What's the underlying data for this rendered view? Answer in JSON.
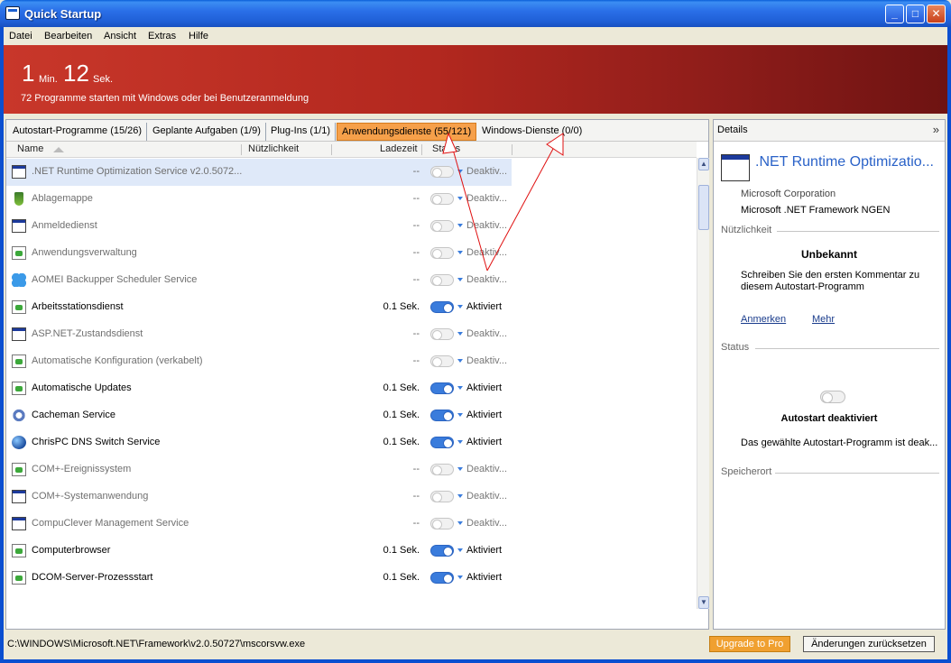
{
  "window": {
    "title": "Quick Startup",
    "min_label": "_",
    "max_label": "□",
    "close_label": "✕"
  },
  "menu": [
    "Datei",
    "Bearbeiten",
    "Ansicht",
    "Extras",
    "Hilfe"
  ],
  "banner": {
    "minutes": "1",
    "minutes_unit": "Min.",
    "seconds": "12",
    "seconds_unit": "Sek.",
    "subtext": "72 Programme starten mit Windows oder bei Benutzeranmeldung",
    "color_start": "#c8372a",
    "color_end": "#6e1312"
  },
  "tabs": [
    {
      "label": "Autostart-Programme (15/26)",
      "active": false
    },
    {
      "label": "Geplante Aufgaben (1/9)",
      "active": false
    },
    {
      "label": "Plug-Ins (1/1)",
      "active": false
    },
    {
      "label": "Anwendungsdienste (55/121)",
      "active": true
    },
    {
      "label": "Windows-Dienste (0/0)",
      "active": false
    }
  ],
  "columns": {
    "name": "Name",
    "usefulness": "Nützlichkeit",
    "load_time": "Ladezeit",
    "status": "Status"
  },
  "rows": [
    {
      "icon": "window",
      "name": ".NET Runtime Optimization Service v2.0.5072...",
      "load": "--",
      "on": false,
      "status": "Deaktiv...",
      "selected": true
    },
    {
      "icon": "plug",
      "name": "Ablagemappe",
      "load": "--",
      "on": false,
      "status": "Deaktiv..."
    },
    {
      "icon": "window",
      "name": "Anmeldedienst",
      "load": "--",
      "on": false,
      "status": "Deaktiv..."
    },
    {
      "icon": "doc",
      "name": "Anwendungsverwaltung",
      "load": "--",
      "on": false,
      "status": "Deaktiv..."
    },
    {
      "icon": "butterfly",
      "name": "AOMEI Backupper Scheduler Service",
      "load": "--",
      "on": false,
      "status": "Deaktiv..."
    },
    {
      "icon": "doc",
      "name": "Arbeitsstationsdienst",
      "load": "0.1 Sek.",
      "on": true,
      "status": "Aktiviert"
    },
    {
      "icon": "window",
      "name": "ASP.NET-Zustandsdienst",
      "load": "--",
      "on": false,
      "status": "Deaktiv..."
    },
    {
      "icon": "doc",
      "name": "Automatische Konfiguration (verkabelt)",
      "load": "--",
      "on": false,
      "status": "Deaktiv..."
    },
    {
      "icon": "doc",
      "name": "Automatische Updates",
      "load": "0.1 Sek.",
      "on": true,
      "status": "Aktiviert"
    },
    {
      "icon": "gear",
      "name": "Cacheman Service",
      "load": "0.1 Sek.",
      "on": true,
      "status": "Aktiviert"
    },
    {
      "icon": "globe",
      "name": "ChrisPC DNS Switch Service",
      "load": "0.1 Sek.",
      "on": true,
      "status": "Aktiviert"
    },
    {
      "icon": "doc",
      "name": "COM+-Ereignissystem",
      "load": "--",
      "on": false,
      "status": "Deaktiv..."
    },
    {
      "icon": "window",
      "name": "COM+-Systemanwendung",
      "load": "--",
      "on": false,
      "status": "Deaktiv..."
    },
    {
      "icon": "window",
      "name": "CompuClever Management Service",
      "load": "--",
      "on": false,
      "status": "Deaktiv..."
    },
    {
      "icon": "doc",
      "name": "Computerbrowser",
      "load": "0.1 Sek.",
      "on": true,
      "status": "Aktiviert"
    },
    {
      "icon": "doc",
      "name": "DCOM-Server-Prozessstart",
      "load": "0.1 Sek.",
      "on": true,
      "status": "Aktiviert"
    }
  ],
  "details": {
    "header": "Details",
    "expand_label": "»",
    "name": ".NET Runtime Optimizatio...",
    "company": "Microsoft Corporation",
    "product": "Microsoft .NET Framework NGEN",
    "usefulness_section": "Nützlichkeit",
    "usefulness_value": "Unbekannt",
    "comment_line1": "Schreiben Sie den ersten Kommentar zu",
    "comment_line2": "diesem Autostart-Programm",
    "link_comment": "Anmerken",
    "link_more": "Mehr",
    "status_section": "Status",
    "status_title": "Autostart deaktiviert",
    "status_desc": "Das gewählte Autostart-Programm ist deak...",
    "location_section": "Speicherort"
  },
  "statusbar": {
    "path": "C:\\WINDOWS\\Microsoft.NET\\Framework\\v2.0.50727\\mscorsvw.exe",
    "upgrade_label": "Upgrade to Pro",
    "reset_label": "Änderungen zurücksetzen"
  },
  "colors": {
    "accent_tab": "#f6a04a",
    "toggle_on": "#3a7cdc",
    "link": "#1a3c8c",
    "annotation_arrow": "#e01010"
  }
}
